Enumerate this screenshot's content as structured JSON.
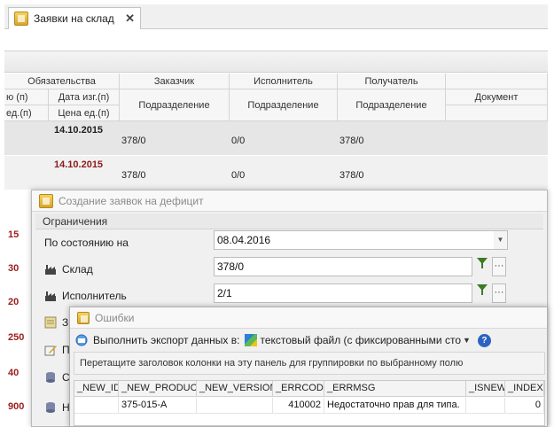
{
  "tab": {
    "title": "Заявки на склад",
    "close": "✕"
  },
  "grid": {
    "group_header": "Обязательства",
    "col_hdr": {
      "customer": "Заказчик",
      "executor": "Исполнитель",
      "receiver": "Получатель"
    },
    "sub_hdr": {
      "partial_left_top": "ю (п)",
      "partial_left_bottom": "ед.(п)",
      "date": "Дата изг.(п)",
      "price": "Цена ед.(п)",
      "customer_div": "Подразделение",
      "executor_div": "Подразделение",
      "receiver_div": "Подразделение",
      "document": "Документ"
    },
    "rows": [
      {
        "date": "14.10.2015",
        "customer": "378/0",
        "executor": "0/0",
        "receiver": "378/0"
      },
      {
        "date": "14.10.2015",
        "customer": "378/0",
        "executor": "0/0",
        "receiver": "378/0"
      }
    ],
    "left_numbers": [
      "15",
      "30",
      "20",
      "250",
      "40",
      "900"
    ]
  },
  "deficit_dialog": {
    "title": "Создание заявок на дефицит",
    "group": "Ограничения",
    "fields": {
      "as_of_label": "По состоянию на",
      "as_of_value": "08.04.2016",
      "warehouse_label": "Склад",
      "warehouse_value": "378/0",
      "executor_label": "Исполнитель",
      "executor_value": "2/1",
      "ellipsis": "···"
    },
    "truncated_items": [
      "З",
      "П",
      "С",
      "Н"
    ]
  },
  "errors_dialog": {
    "title": "Ошибки",
    "export_label": "Выполнить экспорт данных в:",
    "export_value": "текстовый файл (с фиксированными сто",
    "help": "?",
    "group_panel_hint": "Перетащите заголовок колонки на эту панель для группировки по выбранному полю",
    "columns": [
      "_NEW_ID",
      "_NEW_PRODUCT",
      "_NEW_VERSION",
      "_ERRCODE",
      "_ERRMSG",
      "_ISNEW",
      "_INDEX"
    ],
    "rows": [
      {
        "new_id": "",
        "new_product": "375-015-А",
        "new_version": "",
        "errcode": "410002",
        "errmsg": "Недостаточно прав для типа.",
        "isnew": "",
        "index": "0"
      }
    ]
  }
}
